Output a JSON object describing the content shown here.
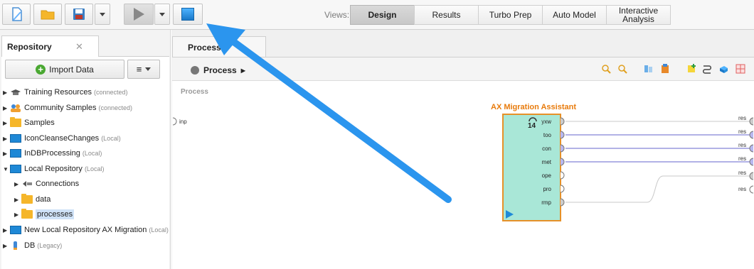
{
  "toolbar": {
    "views_label": "Views:",
    "view_tabs": [
      "Design",
      "Results",
      "Turbo Prep",
      "Auto Model",
      "Interactive Analysis"
    ],
    "active_view": "Design"
  },
  "repository": {
    "tab_label": "Repository",
    "close_glyph": "✕",
    "import_label": "Import Data",
    "menu_glyph": "≡",
    "tree": [
      {
        "label": "Training Resources",
        "sub": "(connected)",
        "icon": "training-icon"
      },
      {
        "label": "Community Samples",
        "sub": "(connected)",
        "icon": "community-icon"
      },
      {
        "label": "Samples",
        "sub": "",
        "icon": "folder-icon"
      },
      {
        "label": "IconCleanseChanges",
        "sub": "(Local)",
        "icon": "monitor-icon"
      },
      {
        "label": "InDBProcessing",
        "sub": "(Local)",
        "icon": "monitor-icon"
      },
      {
        "label": "Local Repository",
        "sub": "(Local)",
        "icon": "monitor-icon"
      },
      {
        "label": "Connections",
        "sub": "",
        "icon": "connections-icon"
      },
      {
        "label": "data",
        "sub": "",
        "icon": "folder-icon"
      },
      {
        "label": "processes",
        "sub": "",
        "icon": "folder-icon"
      },
      {
        "label": "New Local Repository AX Migration",
        "sub": "(Local)",
        "icon": "monitor-icon"
      },
      {
        "label": "DB",
        "sub": "(Legacy)",
        "icon": "db-icon"
      }
    ]
  },
  "process": {
    "tab_label": "Process",
    "breadcrumb": "Process",
    "canvas_label": "Process",
    "input_port": "inp",
    "operator": {
      "title": "AX Migration Assistant",
      "number": "14",
      "ports": [
        "yxw",
        "too",
        "con",
        "met",
        "ope",
        "pro",
        "rmp"
      ]
    },
    "result_ports": [
      "res",
      "res",
      "res",
      "res",
      "res",
      "res"
    ]
  },
  "colors": {
    "arrow": "#2196f3",
    "operator_fill": "#a9e7d7",
    "operator_border": "#e69128",
    "connection": "#9999dd"
  }
}
